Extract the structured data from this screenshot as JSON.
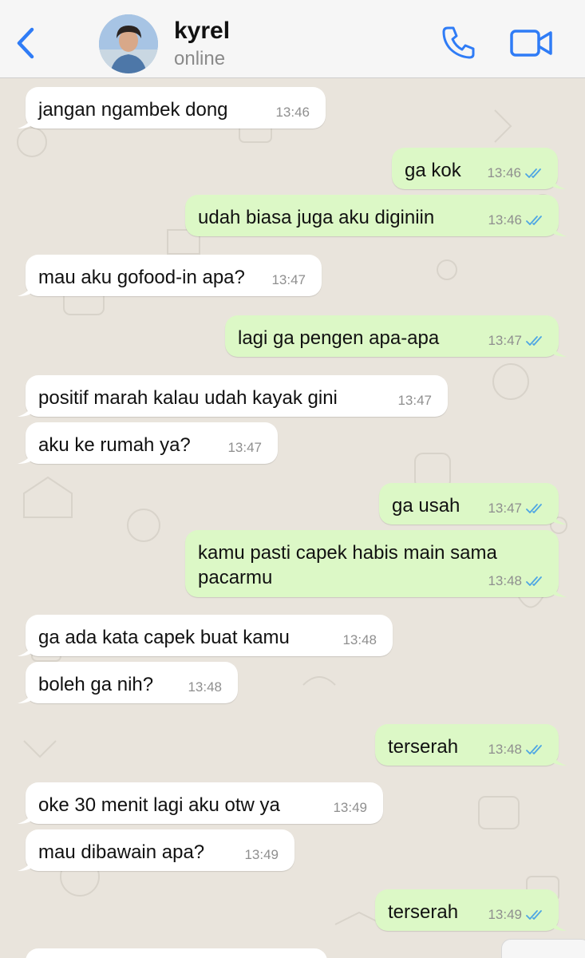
{
  "contact": {
    "name": "kyrel",
    "status": "online"
  },
  "icons": {
    "back": "chevron-left-icon",
    "call": "phone-icon",
    "video": "video-camera-icon",
    "read": "double-check-icon"
  },
  "colors": {
    "accent": "#2f7cf6",
    "outgoing_bubble": "#dcf8c6",
    "incoming_bubble": "#ffffff",
    "wallpaper": "#e9e4dc",
    "read_ticks": "#4fa6e3"
  },
  "messages": [
    {
      "dir": "in",
      "text": "jangan ngambek dong",
      "time": "13:46"
    },
    {
      "dir": "out",
      "text": "ga kok",
      "time": "13:46"
    },
    {
      "dir": "out",
      "text": "udah biasa juga aku diginiin",
      "time": "13:46"
    },
    {
      "dir": "in",
      "text": "mau aku gofood-in apa?",
      "time": "13:47"
    },
    {
      "dir": "out",
      "text": "lagi ga pengen apa-apa",
      "time": "13:47"
    },
    {
      "dir": "in",
      "text": "positif marah kalau udah kayak gini",
      "time": "13:47"
    },
    {
      "dir": "in",
      "text": "aku ke rumah ya?",
      "time": "13:47"
    },
    {
      "dir": "out",
      "text": "ga usah",
      "time": "13:47"
    },
    {
      "dir": "out",
      "text": "kamu pasti capek habis main sama pacarmu",
      "time": "13:48"
    },
    {
      "dir": "in",
      "text": "ga ada kata capek buat kamu",
      "time": "13:48"
    },
    {
      "dir": "in",
      "text": "boleh ga nih?",
      "time": "13:48"
    },
    {
      "dir": "out",
      "text": "terserah",
      "time": "13:48"
    },
    {
      "dir": "in",
      "text": "oke 30 menit lagi aku otw ya",
      "time": "13:49"
    },
    {
      "dir": "in",
      "text": "mau dibawain apa?",
      "time": "13:49"
    },
    {
      "dir": "out",
      "text": "terserah",
      "time": "13:49"
    }
  ]
}
